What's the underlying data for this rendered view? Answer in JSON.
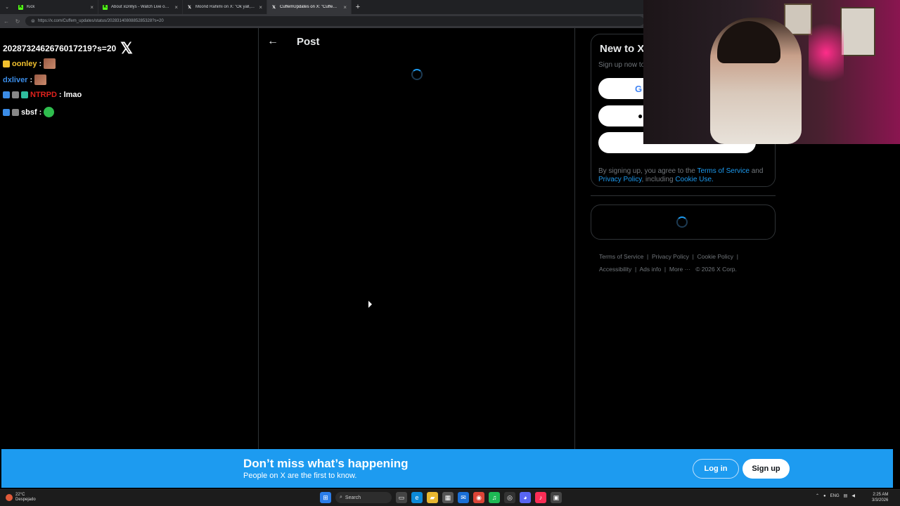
{
  "browser": {
    "tabs": [
      {
        "title": "Kick",
        "fav": "K",
        "favColor": "#53fc18"
      },
      {
        "title": "About xDrillys - Watch Live on Kick",
        "fav": "K",
        "favColor": "#53fc18"
      },
      {
        "title": "Moond Rahimi on X: \"Ok yall, if y",
        "fav": "X",
        "favColor": "#000000"
      },
      {
        "title": "CuffemUpdates on X: \"Cuffem ke",
        "fav": "X",
        "favColor": "#000000"
      }
    ],
    "url": "https://x.com/Cuffem_updates/status/2028314080885285328?s=20"
  },
  "chat": {
    "header": "2028732462676017219?s=20",
    "messages": [
      {
        "user": "oonley",
        "sep": ":",
        "text": "",
        "userColor": "#f2c12e"
      },
      {
        "user": "dxliver",
        "sep": ":",
        "text": "",
        "userColor": "#3b8de8"
      },
      {
        "user": "NTRPD",
        "sep": ":",
        "text": "lmao",
        "userColor": "#e0221d"
      },
      {
        "user": "sbsf",
        "sep": ":",
        "text": "",
        "userColor": "#ffffff"
      }
    ]
  },
  "main": {
    "back_icon": "arrow-left-icon",
    "title": "Post"
  },
  "sidebar": {
    "heading": "New to X",
    "subheading": "Sign up now to",
    "terms_prefix": "By signing up, you agree to the ",
    "terms_link": "Terms of Service",
    "terms_and": " and",
    "privacy_link": "Privacy Policy",
    "terms_including": ", including ",
    "cookie_link": "Cookie Use.",
    "footer": {
      "links": [
        "Terms of Service",
        "Privacy Policy",
        "Cookie Policy",
        "Accessibility",
        "Ads info",
        "More ···"
      ],
      "copyright": "© 2026 X Corp."
    }
  },
  "banner": {
    "headline": "Don’t miss what’s happening",
    "subline": "People on X are the first to know.",
    "login": "Log in",
    "signup": "Sign up"
  },
  "taskbar": {
    "temp": "22°C",
    "weather": "Despejado",
    "search": "Search",
    "lang": "ENG",
    "time": "2:25 AM",
    "date": "3/3/2026"
  }
}
